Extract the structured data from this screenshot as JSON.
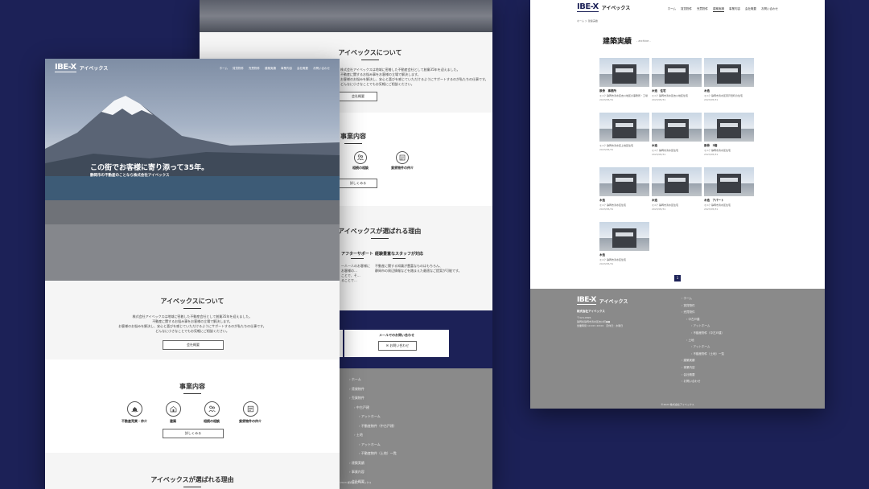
{
  "brand": {
    "logo_mark": "IBE-X",
    "name": "アイベックス",
    "navy": "#1c2157",
    "footer_gray": "#8a8a8a"
  },
  "nav": [
    "ホーム",
    "賃貸物件",
    "売買物件",
    "建築実績",
    "事業内容",
    "会社概要",
    "お問い合わせ"
  ],
  "hero": {
    "headline": "この街でお客様に寄り添って35年。",
    "subline": "静岡市の不動産のことなら株式会社アイベックス"
  },
  "about": {
    "title": "アイベックスについて",
    "lines": [
      "株式会社アイベックスは地域に密着した不動産会社として創業35年を迎えました。",
      "不動産に関するお悩み事をお客様の立場で解決します。",
      "お客様のお悩みを解決し、安心と喜びを感じていただけるようにサポートするのが私たちの仕事です。",
      "どんなに小さなことでもお気軽にご相談ください。"
    ],
    "button": "会社概要"
  },
  "business": {
    "title": "事業内容",
    "services": [
      {
        "label": "不動産売買・仲介",
        "icon": "house-hand-icon"
      },
      {
        "label": "建築",
        "icon": "building-icon"
      },
      {
        "label": "相続の相談",
        "icon": "family-icon"
      },
      {
        "label": "賃貸物件の仲介",
        "icon": "document-icon"
      }
    ],
    "button": "詳しくみる"
  },
  "why": {
    "title": "アイベックスが選ばれる理由",
    "points": [
      {
        "title": "アフターサポート",
        "lines": [
          "一人一人のお客様に",
          "お客様の…",
          "ことで、そ…",
          "ることで…"
        ]
      },
      {
        "title": "経験豊富なスタッフが対応",
        "lines": [
          "不動産に関する知識が豊富なものはもちろん、",
          "静岡市の周辺情報などを踏まえた最適なご提案が可能です。"
        ]
      }
    ]
  },
  "contact": {
    "mail_label": "メールでのお問い合わせ",
    "mail_button": "お問い合わせ"
  },
  "footer": {
    "company": "株式会社アイベックス",
    "address_lines": [
      "〒424-0826",
      "静岡県静岡市清水区吉川町●●",
      "営業時間 10:00～18:00　定休日：水曜日"
    ],
    "links": [
      {
        "label": "ホーム",
        "level": 0
      },
      {
        "label": "賃貸物件",
        "level": 0
      },
      {
        "label": "売買物件",
        "level": 0
      },
      {
        "label": "中古戸建",
        "level": 1
      },
      {
        "label": "アットホーム",
        "level": 2
      },
      {
        "label": "不動産物件（中古戸建）",
        "level": 2
      },
      {
        "label": "土地",
        "level": 1
      },
      {
        "label": "アットホーム",
        "level": 2
      },
      {
        "label": "不動産物件（土地）一覧",
        "level": 2
      },
      {
        "label": "建築実績",
        "level": 0
      },
      {
        "label": "事業内容",
        "level": 0
      },
      {
        "label": "会社概要",
        "level": 0
      },
      {
        "label": "お問い合わせ",
        "level": 0
      }
    ],
    "copyright": "©2023 株式会社アイベックス"
  },
  "works": {
    "breadcrumb": "ホーム ＞ 建築実績",
    "title": "建築実績",
    "subtitle": "- archive -",
    "items": [
      {
        "title": "鉄骨　事務所",
        "desc": "ミニ？静岡市清水区吉川地区の事務所・工場",
        "date": "2023/05/31"
      },
      {
        "title": "木造　住宅",
        "desc": "ミニ？静岡市清水区吉川地区住宅",
        "date": "2023/05/31"
      },
      {
        "title": "木造",
        "desc": "ミニ？静岡市清水区東戸田町の住宅",
        "date": "2023/05/31"
      },
      {
        "title": "",
        "desc": "ミニ？静岡市清水区上地区住宅",
        "date": "2023/05/31"
      },
      {
        "title": "木造",
        "desc": "ミニ？静岡市清水区住宅",
        "date": "2023/05/31"
      },
      {
        "title": "鉄骨　3階",
        "desc": "ミニ？静岡市清水区住宅",
        "date": "2023/05/31"
      },
      {
        "title": "木造",
        "desc": "ミニ？静岡市清水区住宅",
        "date": "2023/05/31"
      },
      {
        "title": "木造",
        "desc": "ミニ？静岡市清水区住宅",
        "date": "2023/05/31"
      },
      {
        "title": "木造　アパート",
        "desc": "ミニ？静岡市清水区住宅",
        "date": "2023/05/31"
      },
      {
        "title": "木造",
        "desc": "ミニ？静岡市清水区住宅",
        "date": "2023/05/31"
      }
    ],
    "page": "1"
  }
}
